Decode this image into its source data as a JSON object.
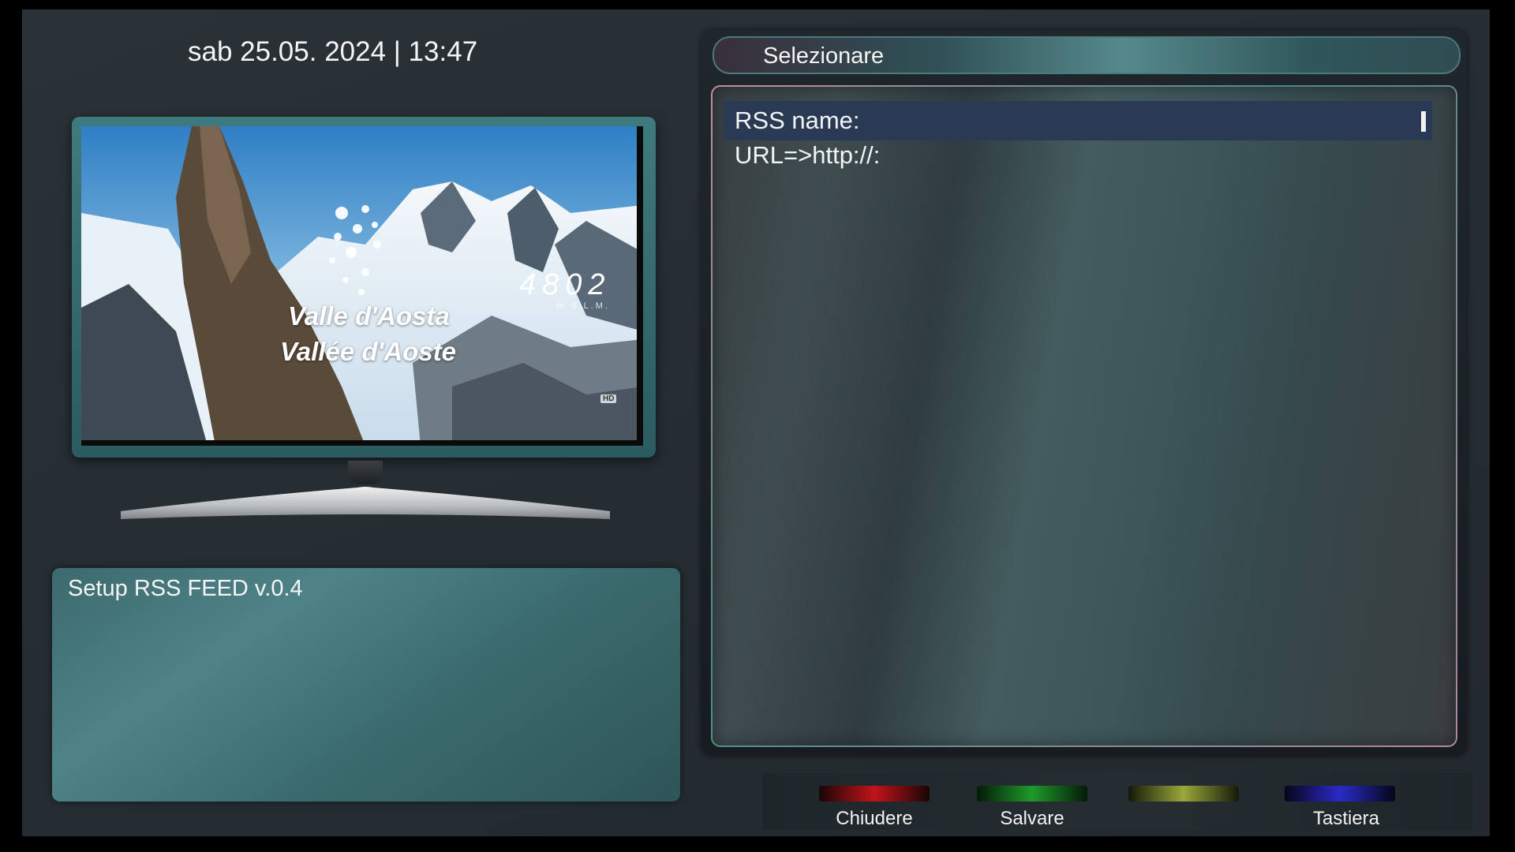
{
  "datetime": "sab 25.05. 2024 | 13:47",
  "preview": {
    "logo_line1": "Valle d'Aosta",
    "logo_line2": "Vallée d'Aoste",
    "altitude": "4802",
    "altitude_unit": "M.S.L.M.",
    "badge": "HD"
  },
  "info": {
    "title": "Setup RSS FEED v.0.4"
  },
  "panel": {
    "header": "Selezionare",
    "rows": [
      {
        "label": "RSS name:",
        "selected": true
      },
      {
        "label": "URL=>http://:",
        "selected": false
      }
    ]
  },
  "footer": {
    "red_label": "Chiudere",
    "green_label": "Salvare",
    "yellow_label": "",
    "blue_label": "Tastiera",
    "colors": {
      "red": "#c0141a",
      "green": "#1e9a2a",
      "yellow": "#9aa83a",
      "blue": "#2a2ac8"
    }
  }
}
